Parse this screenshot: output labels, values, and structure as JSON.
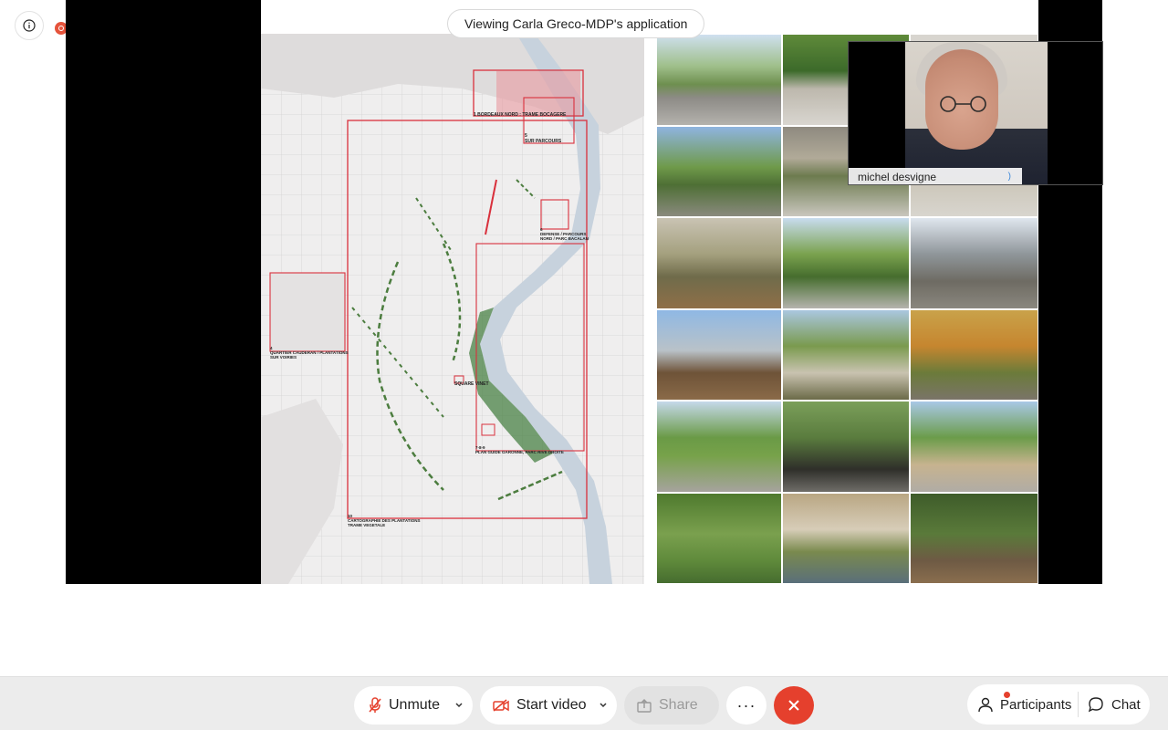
{
  "banner": {
    "text": "Viewing Carla Greco-MDP's application"
  },
  "video": {
    "participant_name": "michel desvigne"
  },
  "map": {
    "labels": {
      "l1": "1",
      "l1_text": "BORDEAUX NORD : TRAME BOCAGERE",
      "l5": "5",
      "l5_text": "SUR PARCOURS",
      "l6": "6",
      "l6_text": "DEFENSE / PARCOURS NORD / PARC BACALAN",
      "l4": "4",
      "l4_text": "QUARTIER CAUDERAN / PLANTATIONS SUR VOIRIES",
      "lsq": "SQUARE VINET",
      "l789": "7-8-9",
      "l789_text": "PLAN GUIDE GARONNE, PARC RIVE DROITE",
      "l10": "10",
      "l10_text": "CARTOGRAPHIE DES PLANTATIONS",
      "l10_sub": "TRAME VEGETALE"
    }
  },
  "toolbar": {
    "unmute_label": "Unmute",
    "start_video_label": "Start video",
    "share_label": "Share",
    "more_label": "···",
    "participants_label": "Participants",
    "chat_label": "Chat"
  },
  "colors": {
    "end_call": "#e5402d",
    "accent_red": "#e5533b",
    "map_red": "#d9303c"
  },
  "icons": [
    "info-icon",
    "recording-icon",
    "mic-muted-icon",
    "video-off-icon",
    "share-icon",
    "chevron-down-icon",
    "close-icon",
    "participants-icon",
    "chat-icon"
  ]
}
